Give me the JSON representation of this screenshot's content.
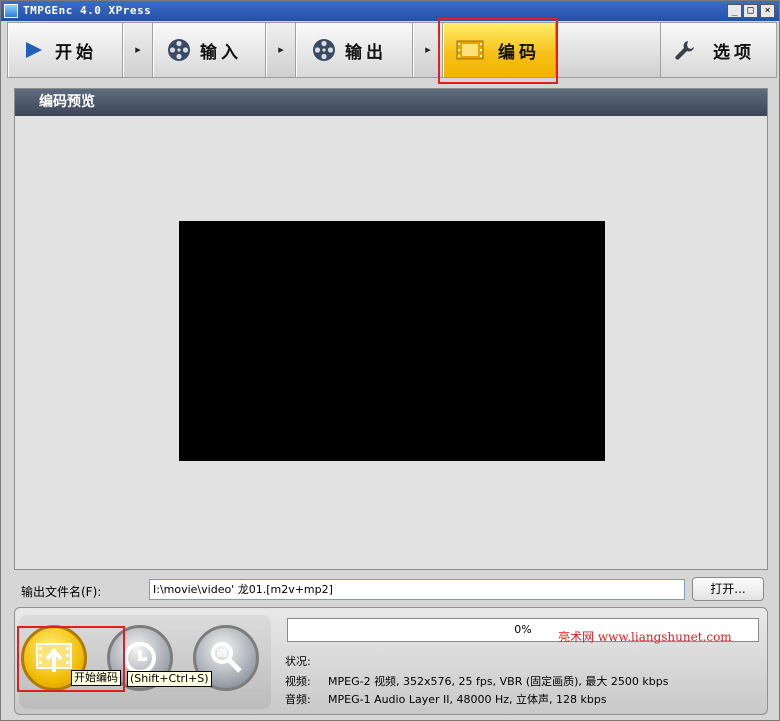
{
  "window": {
    "title": "TMPGEnc 4.0 XPress",
    "controls": {
      "minimize": "_",
      "maximize": "□",
      "close": "×"
    }
  },
  "toolbar": {
    "steps": [
      {
        "label": "开始",
        "icon": "play-arrow-icon"
      },
      {
        "label": "输入",
        "icon": "film-reel-icon"
      },
      {
        "label": "输出",
        "icon": "film-reel-icon"
      },
      {
        "label": "编码",
        "icon": "film-strip-icon",
        "active": true
      },
      {
        "label": "选项",
        "icon": "wrench-icon"
      }
    ],
    "separator": "▸",
    "active_color": "#f6c11a"
  },
  "panel": {
    "title": "编码预览"
  },
  "output": {
    "label": "输出文件名(F):",
    "value": "I:\\movie\\video'                龙01.[m2v+mp2]",
    "open_button": "打开..."
  },
  "controls": {
    "start_encode_tooltip": "开始编码",
    "shortcut_tooltip": "(Shift+Ctrl+S)",
    "buttons": [
      {
        "name": "start-encode-button",
        "icon": "film-upload-icon"
      },
      {
        "name": "schedule-button",
        "icon": "clock-icon"
      },
      {
        "name": "preview-search-button",
        "icon": "magnifier-film-icon"
      }
    ]
  },
  "progress": {
    "label": "0%",
    "fraction": 0
  },
  "watermark": "亮术网 www.liangshunet.com",
  "status": {
    "status_label": "状况:",
    "video_label": "视频:",
    "video_value": "MPEG-2 视频, 352x576, 25 fps, VBR (固定画质), 最大 2500 kbps",
    "audio_label": "音频:",
    "audio_value": "MPEG-1 Audio Layer II, 48000 Hz, 立体声, 128 kbps"
  }
}
